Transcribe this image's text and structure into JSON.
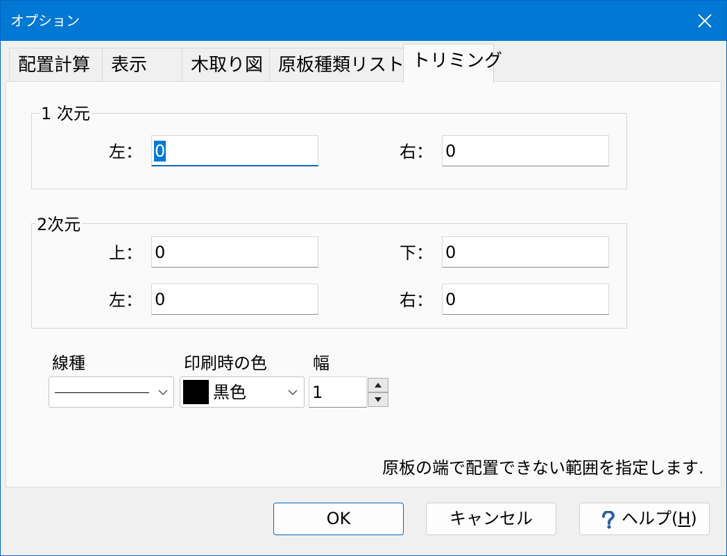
{
  "window": {
    "title": "オプション"
  },
  "tabs": [
    {
      "label": "配置計算"
    },
    {
      "label": "表示"
    },
    {
      "label": "木取り図"
    },
    {
      "label": "原板種類リスト"
    },
    {
      "label": "トリミング",
      "active": true
    }
  ],
  "group_1d": {
    "title": "1 次元",
    "left_label": "左：",
    "left_value": "0",
    "right_label": "右：",
    "right_value": "0"
  },
  "group_2d": {
    "title": "2次元",
    "top_label": "上：",
    "top_value": "0",
    "bottom_label": "下：",
    "bottom_value": "0",
    "left_label": "左：",
    "left_value": "0",
    "right_label": "右：",
    "right_value": "0"
  },
  "line": {
    "type_label": "線種",
    "color_label": "印刷時の色",
    "color_value": "黒色",
    "color_swatch": "#000000",
    "width_label": "幅",
    "width_value": "1"
  },
  "hint": "原板の端で配置できない範囲を指定します.",
  "buttons": {
    "ok": "OK",
    "cancel": "キャンセル",
    "help_prefix": "ヘルプ(",
    "help_key": "H",
    "help_suffix": ")"
  },
  "colors": {
    "accent": "#0078d4",
    "focus": "#0067c0"
  }
}
